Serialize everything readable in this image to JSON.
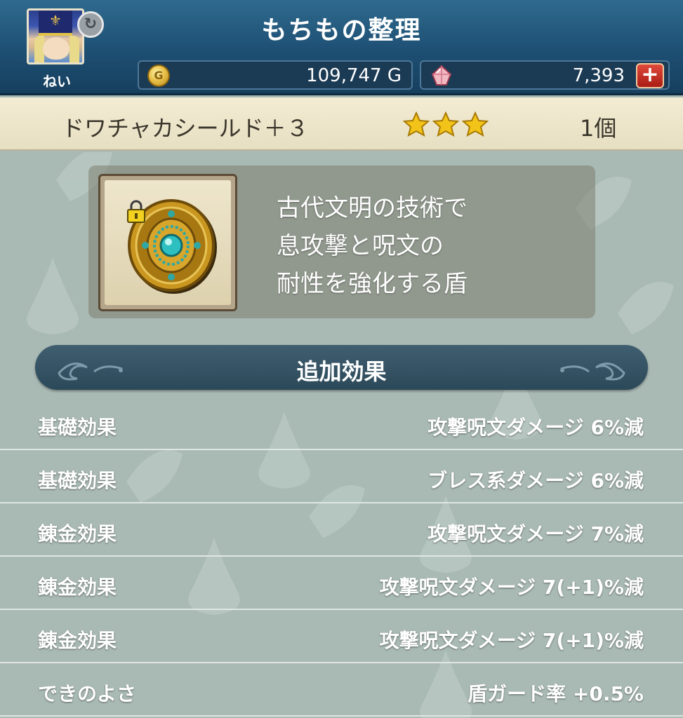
{
  "header": {
    "title": "もちもの整理",
    "player_name": "ねい",
    "gold": {
      "value": "109,747 G",
      "icon": "gold-coin-icon",
      "icon_letter": "G"
    },
    "gems": {
      "value": "7,393",
      "icon": "gem-icon",
      "add_label": "+"
    },
    "swap_icon": "↻"
  },
  "item": {
    "name": "ドワチャカシールド＋３",
    "stars": 3,
    "count": "1個",
    "icon": "shield-icon",
    "locked": true,
    "description": [
      "古代文明の技術で",
      "息攻撃と呪文の",
      "耐性を強化する盾"
    ]
  },
  "section": {
    "title": "追加効果"
  },
  "effects": [
    {
      "label": "基礎効果",
      "value": "攻撃呪文ダメージ  6%減"
    },
    {
      "label": "基礎効果",
      "value": "ブレス系ダメージ  6%減"
    },
    {
      "label": "錬金効果",
      "value": "攻撃呪文ダメージ  7%減"
    },
    {
      "label": "錬金効果",
      "value": "攻撃呪文ダメージ  7(+1)%減"
    },
    {
      "label": "錬金効果",
      "value": "攻撃呪文ダメージ  7(+1)%減"
    },
    {
      "label": "できのよさ",
      "value": "盾ガード率  +0.5%"
    }
  ],
  "colors": {
    "header_bg": "#1d4f73",
    "band_bg": "#f3ecd3",
    "body_bg": "#a9b9b4",
    "star": "#f2c318",
    "accent_red": "#c3271c"
  }
}
